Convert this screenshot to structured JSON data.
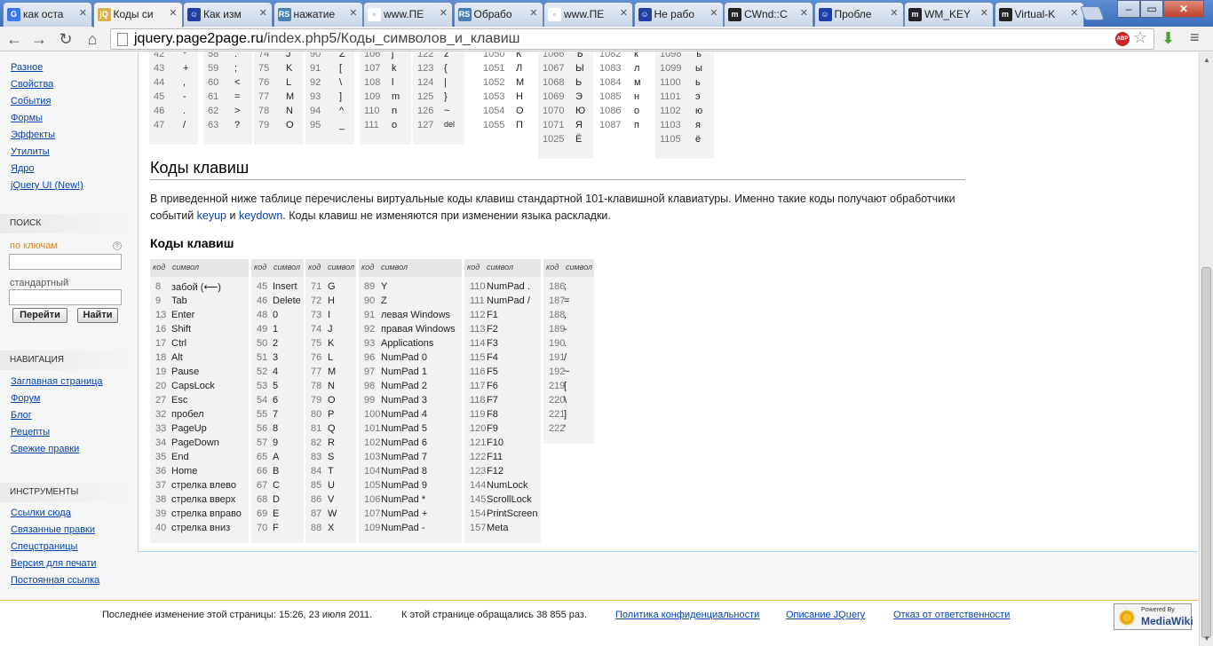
{
  "browser": {
    "tabs": [
      {
        "title": "как оста",
        "icon": "G",
        "color": "#3b78e7",
        "fg": "#fff"
      },
      {
        "title": "Коды си",
        "icon": "jQ",
        "color": "#d7b24c",
        "fg": "#fff",
        "active": true
      },
      {
        "title": "Как изм",
        "icon": "☺",
        "color": "#1f3fa6",
        "fg": "#fff"
      },
      {
        "title": "нажатие",
        "icon": "RS",
        "color": "#4a7fb5",
        "fg": "#fff"
      },
      {
        "title": "www.ПЕ",
        "icon": "▫",
        "color": "#ffffff",
        "fg": "#777"
      },
      {
        "title": "Обрабо",
        "icon": "RS",
        "color": "#4a7fb5",
        "fg": "#fff"
      },
      {
        "title": "www.ПЕ",
        "icon": "▫",
        "color": "#ffffff",
        "fg": "#777"
      },
      {
        "title": "Не рабо",
        "icon": "☺",
        "color": "#1f3fa6",
        "fg": "#fff"
      },
      {
        "title": "CWnd::C",
        "icon": "m",
        "color": "#222222",
        "fg": "#fff"
      },
      {
        "title": "Пробле",
        "icon": "☺",
        "color": "#1f3fa6",
        "fg": "#fff"
      },
      {
        "title": "WM_KEY",
        "icon": "m",
        "color": "#222222",
        "fg": "#fff"
      },
      {
        "title": "Virtual-K",
        "icon": "m",
        "color": "#222222",
        "fg": "#fff"
      }
    ],
    "url_host": "jquery.page2page.ru",
    "url_path": "/index.php5/Коды_символов_и_клавиш",
    "abp_label": "ABP"
  },
  "sidebar": {
    "links_top": [
      "Разное",
      "Свойства",
      "События",
      "Формы",
      "Эффекты",
      "Утилиты",
      "Ядро",
      "jQuery UI (New!)"
    ],
    "search": {
      "heading": "ПОИСК",
      "by_keywords": "по ключам",
      "standard": "стандартный",
      "go": "Перейти",
      "find": "Найти",
      "help": "?"
    },
    "nav": {
      "heading": "НАВИГАЦИЯ",
      "links": [
        "Заглавная страница",
        "Форум",
        "Блог",
        "Рецепты",
        "Свежие правки"
      ]
    },
    "tools": {
      "heading": "ИНСТРУМЕНТЫ",
      "links": [
        "Ссылки сюда",
        "Связанные правки",
        "Спецстраницы",
        "Версия для печати",
        "Постоянная ссылка"
      ]
    }
  },
  "ascii_top": {
    "col1": [
      [
        "42",
        "*"
      ],
      [
        "43",
        "+"
      ],
      [
        "44",
        ","
      ],
      [
        "45",
        "-"
      ],
      [
        "46",
        "."
      ],
      [
        "47",
        "/"
      ]
    ],
    "col2": [
      [
        "58",
        ":"
      ],
      [
        "59",
        ";"
      ],
      [
        "60",
        "<"
      ],
      [
        "61",
        "="
      ],
      [
        "62",
        ">"
      ],
      [
        "63",
        "?"
      ]
    ],
    "col3": [
      [
        "74",
        "J"
      ],
      [
        "75",
        "K"
      ],
      [
        "76",
        "L"
      ],
      [
        "77",
        "M"
      ],
      [
        "78",
        "N"
      ],
      [
        "79",
        "O"
      ]
    ],
    "col4": [
      [
        "90",
        "Z"
      ],
      [
        "91",
        "["
      ],
      [
        "92",
        "\\"
      ],
      [
        "93",
        "]"
      ],
      [
        "94",
        "^"
      ],
      [
        "95",
        "_"
      ]
    ],
    "col5": [
      [
        "106",
        "j"
      ],
      [
        "107",
        "k"
      ],
      [
        "108",
        "l"
      ],
      [
        "109",
        "m"
      ],
      [
        "110",
        "n"
      ],
      [
        "111",
        "o"
      ]
    ],
    "col6": [
      [
        "122",
        "z"
      ],
      [
        "123",
        "{"
      ],
      [
        "124",
        "|"
      ],
      [
        "125",
        "}"
      ],
      [
        "126",
        "~"
      ],
      [
        "127",
        "del"
      ]
    ],
    "col7": [
      [
        "1050",
        "К"
      ],
      [
        "1051",
        "Л"
      ],
      [
        "1052",
        "М"
      ],
      [
        "1053",
        "Н"
      ],
      [
        "1054",
        "О"
      ],
      [
        "1055",
        "П"
      ]
    ],
    "col8": [
      [
        "1066",
        "Ъ"
      ],
      [
        "1067",
        "Ы"
      ],
      [
        "1068",
        "Ь"
      ],
      [
        "1069",
        "Э"
      ],
      [
        "1070",
        "Ю"
      ],
      [
        "1071",
        "Я"
      ],
      [
        "1025",
        "Ё"
      ]
    ],
    "col9": [
      [
        "1082",
        "к"
      ],
      [
        "1083",
        "л"
      ],
      [
        "1084",
        "м"
      ],
      [
        "1085",
        "н"
      ],
      [
        "1086",
        "о"
      ],
      [
        "1087",
        "п"
      ]
    ],
    "col10": [
      [
        "1098",
        "ъ"
      ],
      [
        "1099",
        "ы"
      ],
      [
        "1100",
        "ь"
      ],
      [
        "1101",
        "э"
      ],
      [
        "1102",
        "ю"
      ],
      [
        "1103",
        "я"
      ],
      [
        "1105",
        "ё"
      ]
    ]
  },
  "section": {
    "heading": "Коды клавиш",
    "para_1": "В приведенной ниже таблице перечислены виртуальные коды клавиш стандартной 101-клавишной клавиатуры. Именно такие коды получают обработчики событий ",
    "link_keyup": "keyup",
    "para_and": " и ",
    "link_keydown": "keydown",
    "para_2": ". Коды клавиш не изменяются при изменении языка раскладки.",
    "subheading": "Коды клавиш"
  },
  "keytable": {
    "header_code": "код",
    "header_symbol": "символ",
    "columns": [
      [
        [
          "8",
          "забой (⟵)"
        ],
        [
          "9",
          "Tab"
        ],
        [
          "13",
          "Enter"
        ],
        [
          "16",
          "Shift"
        ],
        [
          "17",
          "Ctrl"
        ],
        [
          "18",
          "Alt"
        ],
        [
          "19",
          "Pause"
        ],
        [
          "20",
          "CapsLock"
        ],
        [
          "27",
          "Esc"
        ],
        [
          "32",
          "пробел"
        ],
        [
          "33",
          "PageUp"
        ],
        [
          "34",
          "PageDown"
        ],
        [
          "35",
          "End"
        ],
        [
          "36",
          "Home"
        ],
        [
          "37",
          "стрелка влево"
        ],
        [
          "38",
          "стрелка вверх"
        ],
        [
          "39",
          "стрелка вправо"
        ],
        [
          "40",
          "стрелка вниз"
        ]
      ],
      [
        [
          "45",
          "Insert"
        ],
        [
          "46",
          "Delete"
        ],
        [
          "48",
          "0"
        ],
        [
          "49",
          "1"
        ],
        [
          "50",
          "2"
        ],
        [
          "51",
          "3"
        ],
        [
          "52",
          "4"
        ],
        [
          "53",
          "5"
        ],
        [
          "54",
          "6"
        ],
        [
          "55",
          "7"
        ],
        [
          "56",
          "8"
        ],
        [
          "57",
          "9"
        ],
        [
          "65",
          "A"
        ],
        [
          "66",
          "B"
        ],
        [
          "67",
          "C"
        ],
        [
          "68",
          "D"
        ],
        [
          "69",
          "E"
        ],
        [
          "70",
          "F"
        ]
      ],
      [
        [
          "71",
          "G"
        ],
        [
          "72",
          "H"
        ],
        [
          "73",
          "I"
        ],
        [
          "74",
          "J"
        ],
        [
          "75",
          "K"
        ],
        [
          "76",
          "L"
        ],
        [
          "77",
          "M"
        ],
        [
          "78",
          "N"
        ],
        [
          "79",
          "O"
        ],
        [
          "80",
          "P"
        ],
        [
          "81",
          "Q"
        ],
        [
          "82",
          "R"
        ],
        [
          "83",
          "S"
        ],
        [
          "84",
          "T"
        ],
        [
          "85",
          "U"
        ],
        [
          "86",
          "V"
        ],
        [
          "87",
          "W"
        ],
        [
          "88",
          "X"
        ]
      ],
      [
        [
          "89",
          "Y"
        ],
        [
          "90",
          "Z"
        ],
        [
          "91",
          "левая Windows"
        ],
        [
          "92",
          "правая Windows"
        ],
        [
          "93",
          "Applications"
        ],
        [
          "96",
          "NumPad 0"
        ],
        [
          "97",
          "NumPad 1"
        ],
        [
          "98",
          "NumPad 2"
        ],
        [
          "99",
          "NumPad 3"
        ],
        [
          "100",
          "NumPad 4"
        ],
        [
          "101",
          "NumPad 5"
        ],
        [
          "102",
          "NumPad 6"
        ],
        [
          "103",
          "NumPad 7"
        ],
        [
          "104",
          "NumPad 8"
        ],
        [
          "105",
          "NumPad 9"
        ],
        [
          "106",
          "NumPad *"
        ],
        [
          "107",
          "NumPad +"
        ],
        [
          "109",
          "NumPad -"
        ]
      ],
      [
        [
          "110",
          "NumPad ."
        ],
        [
          "111",
          "NumPad /"
        ],
        [
          "112",
          "F1"
        ],
        [
          "113",
          "F2"
        ],
        [
          "114",
          "F3"
        ],
        [
          "115",
          "F4"
        ],
        [
          "116",
          "F5"
        ],
        [
          "117",
          "F6"
        ],
        [
          "118",
          "F7"
        ],
        [
          "119",
          "F8"
        ],
        [
          "120",
          "F9"
        ],
        [
          "121",
          "F10"
        ],
        [
          "122",
          "F11"
        ],
        [
          "123",
          "F12"
        ],
        [
          "144",
          "NumLock"
        ],
        [
          "145",
          "ScrollLock"
        ],
        [
          "154",
          "PrintScreen"
        ],
        [
          "157",
          "Meta"
        ]
      ],
      [
        [
          "186",
          ";"
        ],
        [
          "187",
          "="
        ],
        [
          "188",
          ","
        ],
        [
          "189",
          "-"
        ],
        [
          "190",
          "."
        ],
        [
          "191",
          "/"
        ],
        [
          "192",
          "~"
        ],
        [
          "219",
          "["
        ],
        [
          "220",
          "\\"
        ],
        [
          "221",
          "]"
        ],
        [
          "222",
          "'"
        ]
      ]
    ]
  },
  "footer": {
    "last_modified": "Последнее изменение этой страницы: 15:26, 23 июля 2011.",
    "views": "К этой странице обращались 38 855 раз.",
    "privacy": "Политика конфиденциальности",
    "about": "Описание JQuery",
    "disclaimer": "Отказ от ответственности",
    "badge_top": "Powered By",
    "badge_main": "MediaWiki"
  }
}
